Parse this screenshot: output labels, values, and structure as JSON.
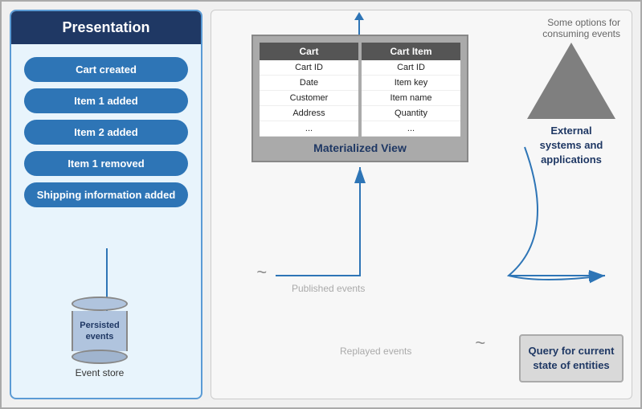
{
  "presentation": {
    "header": "Presentation",
    "events": [
      "Cart created",
      "Item 1 added",
      "Item 2 added",
      "Item 1 removed",
      "Shipping information added"
    ],
    "event_store_label": "Event store",
    "cylinder_text": "Persisted events"
  },
  "main": {
    "options_text": "Some options for\nconsuming events",
    "materialized_view": {
      "title": "Materialized View",
      "cart_table": {
        "header": "Cart",
        "rows": [
          "Cart ID",
          "Date",
          "Customer",
          "Address",
          "..."
        ]
      },
      "cart_item_table": {
        "header": "Cart Item",
        "rows": [
          "Cart ID",
          "Item key",
          "Item name",
          "Quantity",
          "..."
        ]
      }
    },
    "external": {
      "label": "External\nsystems and\napplications"
    },
    "published_events": "Published events",
    "replayed_events": "Replayed events",
    "query_box": "Query for\ncurrent state\nof entities",
    "tilde": "~"
  }
}
